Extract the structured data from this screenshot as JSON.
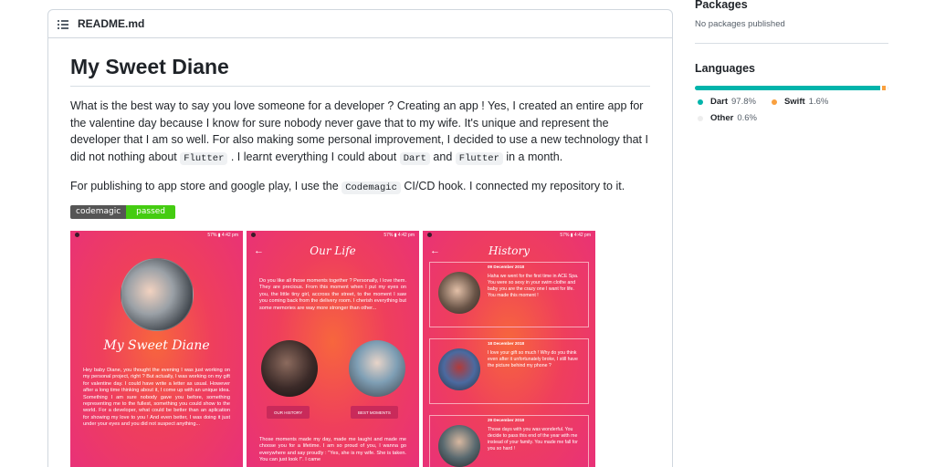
{
  "readme": {
    "filename": "README.md",
    "title": "My Sweet Diane",
    "para1": {
      "text": "What is the best way to say you love someone for a developer ? Creating an app ! Yes, I created an entire app for the valentine day because I know for sure nobody never gave that to my wife. It's unique and represent the developer that I am so well. For also making some personal improvement, I decided to use a new technology that I did not nothing about",
      "code1": "Flutter",
      "mid": ". I learnt everything I could about",
      "code2": "Dart",
      "and": "and",
      "code3": "Flutter",
      "end": "in a month."
    },
    "para2": {
      "pre": "For publishing to app store and google play, I use the",
      "code": "Codemagic",
      "post": "CI/CD hook. I connected my repository to it."
    },
    "badge": {
      "left": "codemagic",
      "right": "passed"
    }
  },
  "screens": {
    "status_text": "57% ▮ 4:42 pm",
    "s1": {
      "title": "My Sweet Diane",
      "text": "Hey baby Diane, you thought the evening I was just working on my personal project, right ? But actually, I was working on my gift for valentine day. I could have write a letter as usual. However after a long time thinking about it, I come up with an unique idea. Something I am sure nobody gave you before, something representing me to the fullest, something you could show to the world. For a developer, what could be better than an aplication for showing my love to you ! And even better, I was doing it just under your eyes and you did not suspect anything..."
    },
    "s2": {
      "title": "Our Life",
      "text": "Do you like all those moments together ? Personally, I love them. They are precious. From this moment when I put my eyes on you, the little tiny girl, accross the street, to the moment I saw you coming back from the delivery room. I cherish everything but some memories are way more stronger than other...",
      "btn1": "OUR HISTORY",
      "btn2": "BEST MOMENTS",
      "bottom": "Those moments made my day, made me laught and made me choose you for a lifetime. I am so proud of you, I wanna go everywhere and say proudly : \"Yes, she is my wife. She is taken. You can just look !\". I came"
    },
    "s3": {
      "title": "History",
      "cards": [
        {
          "date": "09 December 2018",
          "text": "Haha we went for the first time in ACE Spa. You were so sexy in your swim clothe and baby you are the crazy one I want for life. You made this moment !"
        },
        {
          "date": "18 December 2018",
          "text": "I love your gift so much ! Why do you think even after it unfortunately broke, I still have the picture behind my phone ?"
        },
        {
          "date": "29 December 2018",
          "text": "Those days with you was wonderful. You decide to pass this end of the year with me instead of your family. You made me fall for you so hard !"
        }
      ]
    }
  },
  "sidebar": {
    "packages_heading": "Packages",
    "packages_text": "No packages published",
    "languages_heading": "Languages",
    "languages": [
      {
        "name": "Dart",
        "percent": "97.8%",
        "value": 97.8,
        "color": "#00b4ab"
      },
      {
        "name": "Swift",
        "percent": "1.6%",
        "value": 1.6,
        "color": "#f9a03f"
      },
      {
        "name": "Other",
        "percent": "0.6%",
        "value": 0.6,
        "color": "#ededed"
      }
    ]
  }
}
